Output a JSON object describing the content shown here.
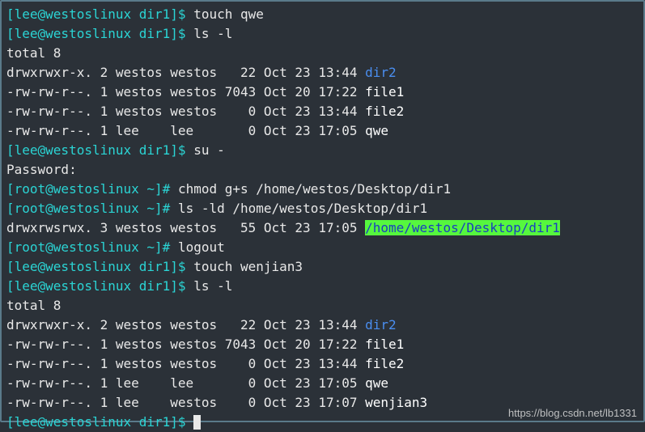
{
  "lines": [
    {
      "prompt": {
        "user": "lee",
        "host": "westoslinux",
        "cwd": "dir1",
        "sep": "$"
      },
      "cmd": "touch qwe"
    },
    {
      "prompt": {
        "user": "lee",
        "host": "westoslinux",
        "cwd": "dir1",
        "sep": "$"
      },
      "cmd": "ls -l"
    },
    {
      "text": "total 8"
    },
    {
      "ls": {
        "perm": "drwxrwxr-x.",
        "n": "2",
        "u": "westos",
        "g": "westos",
        "size": "22",
        "date": "Oct 23 13:44",
        "name": "dir2",
        "dir": true
      }
    },
    {
      "ls": {
        "perm": "-rw-rw-r--.",
        "n": "1",
        "u": "westos",
        "g": "westos",
        "size": "7043",
        "date": "Oct 20 17:22",
        "name": "file1"
      }
    },
    {
      "ls": {
        "perm": "-rw-rw-r--.",
        "n": "1",
        "u": "westos",
        "g": "westos",
        "size": "0",
        "date": "Oct 23 13:44",
        "name": "file2"
      }
    },
    {
      "ls": {
        "perm": "-rw-rw-r--.",
        "n": "1",
        "u": "lee",
        "g": "lee",
        "size": "0",
        "date": "Oct 23 17:05",
        "name": "qwe"
      }
    },
    {
      "prompt": {
        "user": "lee",
        "host": "westoslinux",
        "cwd": "dir1",
        "sep": "$"
      },
      "cmd": "su -"
    },
    {
      "text": "Password:"
    },
    {
      "prompt": {
        "user": "root",
        "host": "westoslinux",
        "cwd": "~",
        "sep": "#"
      },
      "cmd": "chmod g+s /home/westos/Desktop/dir1"
    },
    {
      "prompt": {
        "user": "root",
        "host": "westoslinux",
        "cwd": "~",
        "sep": "#"
      },
      "cmd": "ls -ld /home/westos/Desktop/dir1"
    },
    {
      "ls": {
        "perm": "drwxrwsrwx.",
        "n": "3",
        "u": "westos",
        "g": "westos",
        "size": "55",
        "date": "Oct 23 17:05",
        "name": "/home/westos/Desktop/dir1",
        "hl": true
      }
    },
    {
      "prompt": {
        "user": "root",
        "host": "westoslinux",
        "cwd": "~",
        "sep": "#"
      },
      "cmd": "logout"
    },
    {
      "prompt": {
        "user": "lee",
        "host": "westoslinux",
        "cwd": "dir1",
        "sep": "$"
      },
      "cmd": "touch wenjian3"
    },
    {
      "prompt": {
        "user": "lee",
        "host": "westoslinux",
        "cwd": "dir1",
        "sep": "$"
      },
      "cmd": "ls -l"
    },
    {
      "text": "total 8"
    },
    {
      "ls": {
        "perm": "drwxrwxr-x.",
        "n": "2",
        "u": "westos",
        "g": "westos",
        "size": "22",
        "date": "Oct 23 13:44",
        "name": "dir2",
        "dir": true
      }
    },
    {
      "ls": {
        "perm": "-rw-rw-r--.",
        "n": "1",
        "u": "westos",
        "g": "westos",
        "size": "7043",
        "date": "Oct 20 17:22",
        "name": "file1"
      }
    },
    {
      "ls": {
        "perm": "-rw-rw-r--.",
        "n": "1",
        "u": "westos",
        "g": "westos",
        "size": "0",
        "date": "Oct 23 13:44",
        "name": "file2"
      }
    },
    {
      "ls": {
        "perm": "-rw-rw-r--.",
        "n": "1",
        "u": "lee",
        "g": "lee",
        "size": "0",
        "date": "Oct 23 17:05",
        "name": "qwe"
      }
    },
    {
      "ls": {
        "perm": "-rw-rw-r--.",
        "n": "1",
        "u": "lee",
        "g": "westos",
        "size": "0",
        "date": "Oct 23 17:07",
        "name": "wenjian3"
      }
    },
    {
      "prompt": {
        "user": "lee",
        "host": "westoslinux",
        "cwd": "dir1",
        "sep": "$"
      },
      "cmd": "",
      "cursor": true
    }
  ],
  "watermark": "https://blog.csdn.net/lb1331"
}
